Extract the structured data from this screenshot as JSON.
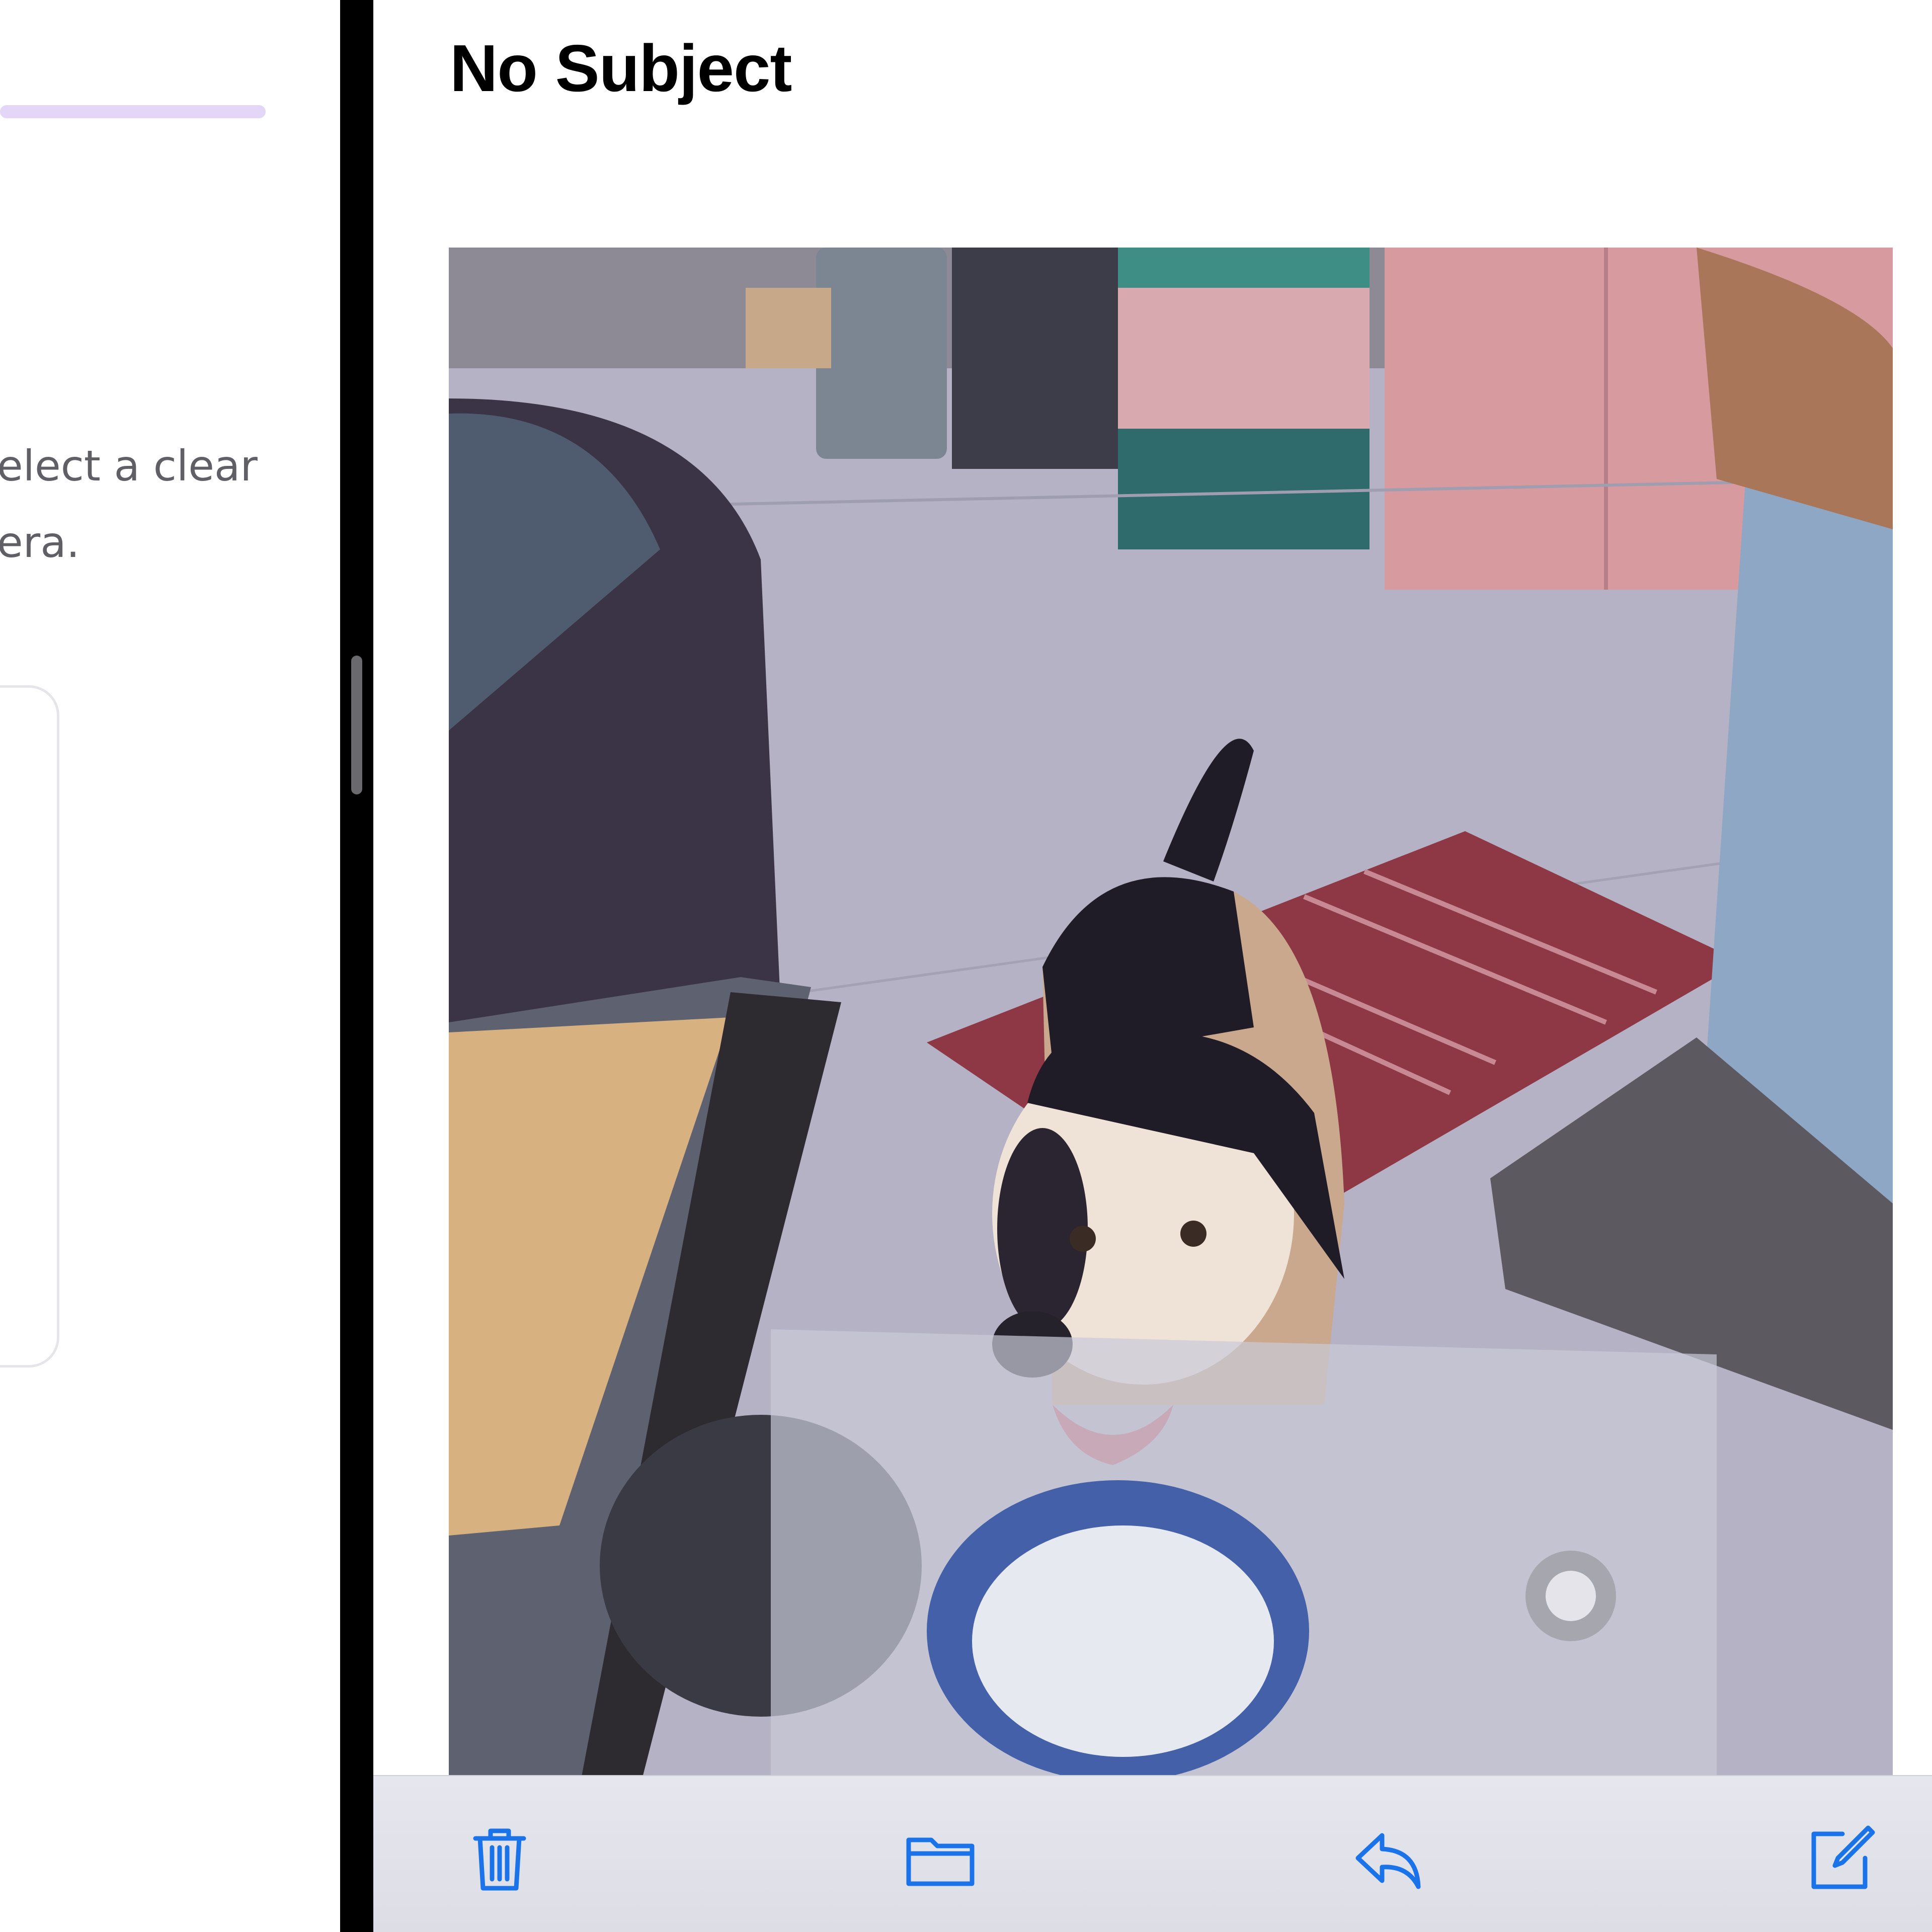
{
  "left_pane": {
    "instruction_text": "elect a clear\nera."
  },
  "mail": {
    "subject": "No Subject",
    "attachment_icon": "photo-of-dog"
  },
  "toolbar": {
    "buttons": [
      {
        "icon": "trash-icon"
      },
      {
        "icon": "folder-icon"
      },
      {
        "icon": "reply-icon"
      },
      {
        "icon": "compose-icon"
      }
    ]
  },
  "colors": {
    "accent": "#1a73e8",
    "progress": "#e4d6f6",
    "divider": "#000000"
  }
}
